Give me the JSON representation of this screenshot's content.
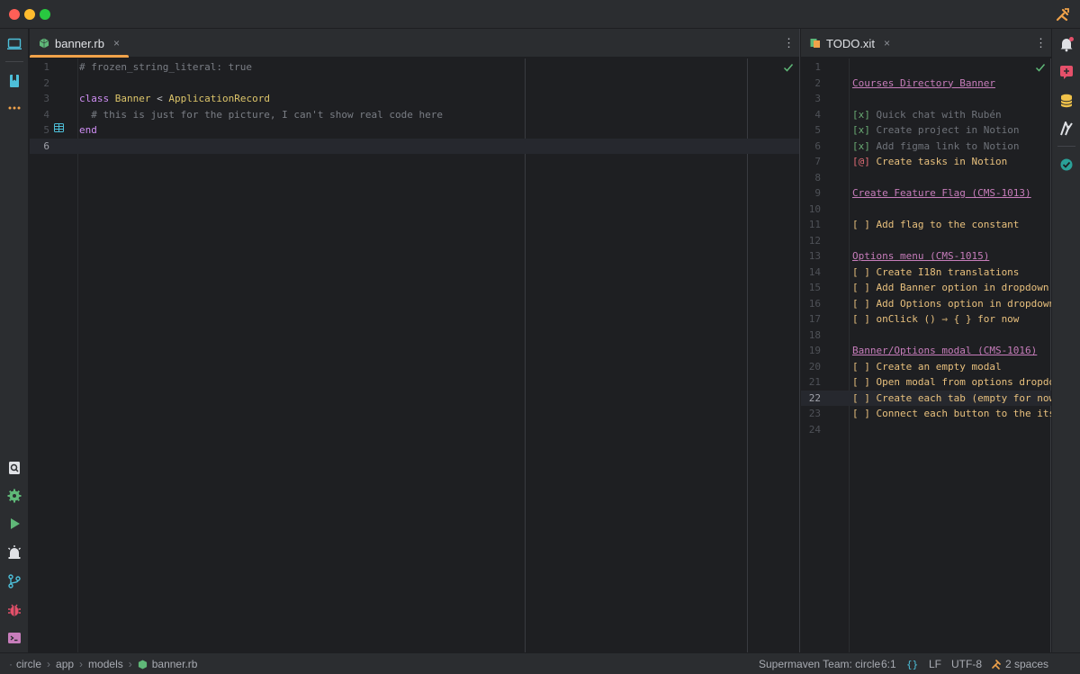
{
  "window": {
    "tool_icon": "build-tools-icon"
  },
  "left_toolbar": {
    "items": [
      "project-icon",
      "bookmarks-icon",
      "more-icon",
      "find-icon",
      "settings-icon",
      "run-icon",
      "services-icon",
      "git-icon",
      "debug-icon",
      "terminal-icon"
    ]
  },
  "right_toolbar": {
    "items": [
      "notifications-icon",
      "ai-assistant-icon",
      "database-icon",
      "gradle-icon",
      "check-icon"
    ]
  },
  "left_editor": {
    "tab": {
      "label": "banner.rb",
      "close": "×",
      "icon": "ruby-file-icon"
    },
    "lines": [
      {
        "n": "1",
        "parts": [
          [
            "# frozen_string_literal: true",
            "c-comment"
          ]
        ]
      },
      {
        "n": "2",
        "parts": []
      },
      {
        "n": "3",
        "parts": [
          [
            "class ",
            "c-kw"
          ],
          [
            "Banner",
            "c-cls"
          ],
          [
            " < ",
            "c-text"
          ],
          [
            "ApplicationRecord",
            "c-cls"
          ]
        ]
      },
      {
        "n": "4",
        "parts": [
          [
            "  # this is just for the picture, I can't show real code here",
            "c-comment"
          ]
        ]
      },
      {
        "n": "5",
        "parts": [
          [
            "end",
            "c-kw"
          ]
        ]
      },
      {
        "n": "6",
        "parts": []
      }
    ],
    "current_line": "6"
  },
  "right_editor": {
    "tab": {
      "label": "TODO.xit",
      "close": "×",
      "icon": "xit-file-icon"
    },
    "lines": [
      {
        "n": "1",
        "parts": []
      },
      {
        "n": "2",
        "parts": [
          [
            "Courses Directory Banner",
            "h-title"
          ]
        ]
      },
      {
        "n": "3",
        "parts": []
      },
      {
        "n": "4",
        "parts": [
          [
            "[x]",
            "x-box"
          ],
          [
            " Quick chat with Rubén",
            "x-done"
          ]
        ]
      },
      {
        "n": "5",
        "parts": [
          [
            "[x]",
            "x-box"
          ],
          [
            " Create project in Notion",
            "x-done"
          ]
        ]
      },
      {
        "n": "6",
        "parts": [
          [
            "[x]",
            "x-box"
          ],
          [
            " Add figma link to Notion",
            "x-done"
          ]
        ]
      },
      {
        "n": "7",
        "parts": [
          [
            "[@]",
            "a-box"
          ],
          [
            " Create tasks in Notion",
            "a-text"
          ]
        ]
      },
      {
        "n": "8",
        "parts": []
      },
      {
        "n": "9",
        "parts": [
          [
            "Create Feature Flag (CMS-1013)",
            "h-title"
          ]
        ]
      },
      {
        "n": "10",
        "parts": []
      },
      {
        "n": "11",
        "parts": [
          [
            "[ ] Add flag to the constant",
            "o-text"
          ]
        ]
      },
      {
        "n": "12",
        "parts": []
      },
      {
        "n": "13",
        "parts": [
          [
            "Options menu (CMS-1015)",
            "h-title"
          ]
        ]
      },
      {
        "n": "14",
        "parts": [
          [
            "[ ] Create I18n translations",
            "o-text"
          ]
        ]
      },
      {
        "n": "15",
        "parts": [
          [
            "[ ] Add Banner option in dropdown",
            "o-text"
          ]
        ]
      },
      {
        "n": "16",
        "parts": [
          [
            "[ ] Add Options option in dropdown",
            "o-text"
          ]
        ]
      },
      {
        "n": "17",
        "parts": [
          [
            "[ ] onClick () ⇒ { } for now",
            "o-text"
          ]
        ]
      },
      {
        "n": "18",
        "parts": []
      },
      {
        "n": "19",
        "parts": [
          [
            "Banner/Options modal (CMS-1016)",
            "h-title"
          ]
        ]
      },
      {
        "n": "20",
        "parts": [
          [
            "[ ] Create an empty modal",
            "o-text"
          ]
        ]
      },
      {
        "n": "21",
        "parts": [
          [
            "[ ] Open modal from options dropdown",
            "o-text"
          ]
        ]
      },
      {
        "n": "22",
        "parts": [
          [
            "[ ] Create each tab (empty for now)",
            "o-text"
          ]
        ]
      },
      {
        "n": "23",
        "parts": [
          [
            "[ ] Connect each button to the its tab",
            "o-text"
          ]
        ]
      },
      {
        "n": "24",
        "parts": []
      }
    ],
    "current_line": "22"
  },
  "statusbar": {
    "breadcrumb": [
      "circle",
      "app",
      "models",
      "banner.rb"
    ],
    "supermaven": "Supermaven Team: circle",
    "position": "6:1",
    "braces": "{}",
    "line_ending": "LF",
    "encoding": "UTF-8",
    "indent": "2 spaces"
  },
  "colors": {
    "accent_tab": "#f0a24a",
    "ruby": "#5fb878",
    "check": "#5fb878"
  }
}
